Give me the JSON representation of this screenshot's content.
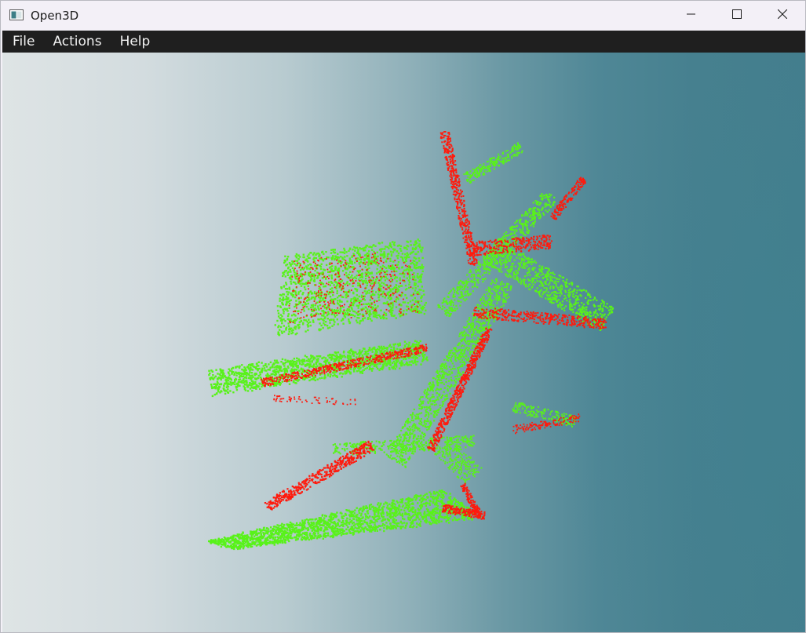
{
  "window": {
    "title": "Open3D",
    "icon": "app-window-icon",
    "controls": [
      "minimize-icon",
      "maximize-icon",
      "close-icon"
    ]
  },
  "menubar": {
    "items": [
      "File",
      "Actions",
      "Help"
    ]
  },
  "viewport": {
    "background": "gradient light gray to teal",
    "point_colors": {
      "source": "#ff1a0d",
      "target": "#59f21a"
    }
  }
}
